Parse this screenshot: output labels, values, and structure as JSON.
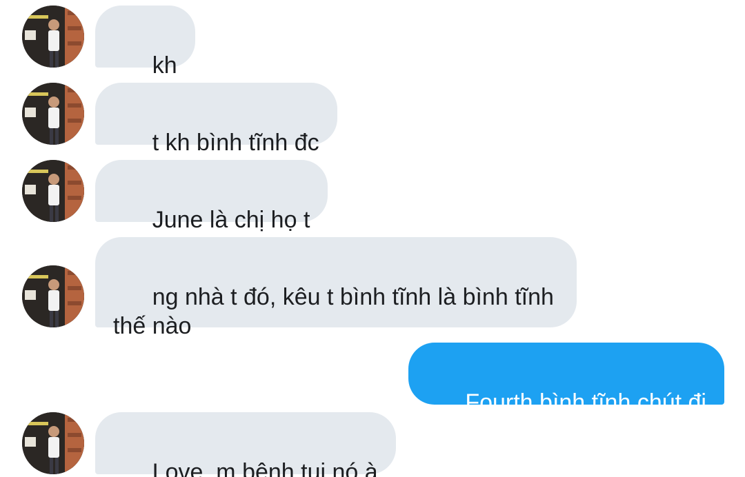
{
  "colors": {
    "incoming_bubble": "#e4e9ee",
    "outgoing_bubble": "#1da1f2",
    "incoming_text": "#1c1e21",
    "outgoing_text": "#ffffff"
  },
  "messages": [
    {
      "direction": "incoming",
      "text": "kh",
      "avatar": "profile-photo-avatar"
    },
    {
      "direction": "incoming",
      "text": "t kh bình tĩnh đc",
      "avatar": "profile-photo-avatar"
    },
    {
      "direction": "incoming",
      "text": "June là chị họ t",
      "avatar": "profile-photo-avatar"
    },
    {
      "direction": "incoming",
      "text": "ng nhà t đó, kêu t bình tĩnh là bình tĩnh\nthế nào",
      "avatar": "profile-photo-avatar"
    },
    {
      "direction": "outgoing",
      "text": "Fourth bình tĩnh chút đi"
    },
    {
      "direction": "incoming",
      "text": "Love, m bênh tụi nó à",
      "avatar": "profile-photo-avatar"
    }
  ]
}
